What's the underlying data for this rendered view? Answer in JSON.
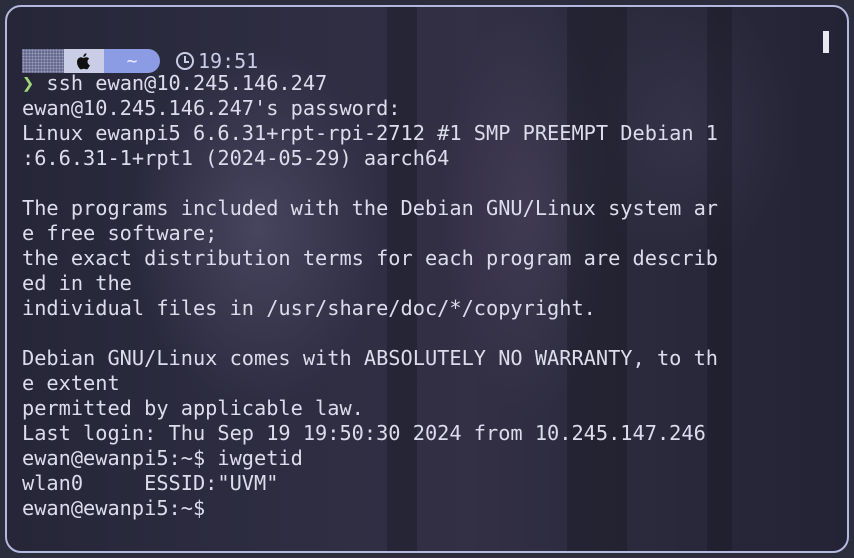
{
  "prompt": {
    "os_icon": "apple-icon",
    "dir": "~",
    "time": "19:51"
  },
  "terminal": {
    "lines": [
      "",
      "❯ ssh ewan@10.245.146.247",
      "ewan@10.245.146.247's password:",
      "Linux ewanpi5 6.6.31+rpt-rpi-2712 #1 SMP PREEMPT Debian 1",
      ":6.6.31-1+rpt1 (2024-05-29) aarch64",
      "",
      "The programs included with the Debian GNU/Linux system ar",
      "e free software;",
      "the exact distribution terms for each program are describ",
      "ed in the",
      "individual files in /usr/share/doc/*/copyright.",
      "",
      "Debian GNU/Linux comes with ABSOLUTELY NO WARRANTY, to th",
      "e extent",
      "permitted by applicable law.",
      "Last login: Thu Sep 19 19:50:30 2024 from 10.245.147.246",
      "ewan@ewanpi5:~$ iwgetid",
      "wlan0     ESSID:\"UVM\"",
      "ewan@ewanpi5:~$"
    ]
  },
  "colors": {
    "border": "#b3b8de",
    "text": "#dcdceb",
    "chevron": "#9fd67a",
    "dir_segment": "#8b9be4",
    "os_segment": "#c9cde6"
  }
}
